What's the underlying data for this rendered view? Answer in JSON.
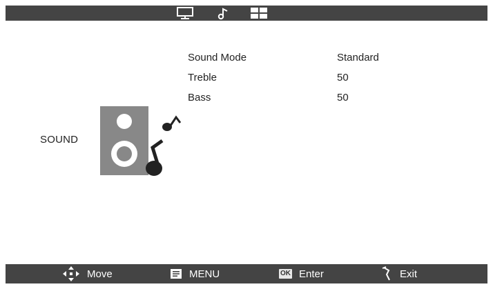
{
  "tabs": [
    {
      "icon": "monitor-icon"
    },
    {
      "icon": "music-note-icon",
      "selected": true
    },
    {
      "icon": "options-grid-icon"
    }
  ],
  "section": {
    "label": "SOUND",
    "icon": "speaker-with-music-notes-icon"
  },
  "menu": {
    "items": [
      {
        "label": "Sound Mode",
        "value": "Standard"
      },
      {
        "label": "Treble",
        "value": "50"
      },
      {
        "label": "Bass",
        "value": "50"
      }
    ]
  },
  "footer": {
    "move": "Move",
    "menu": "MENU",
    "ok_badge": "OK",
    "enter": "Enter",
    "exit": "Exit"
  },
  "colors": {
    "bar": "#444444",
    "background": "#ffffff",
    "speaker_gray": "#888888"
  }
}
